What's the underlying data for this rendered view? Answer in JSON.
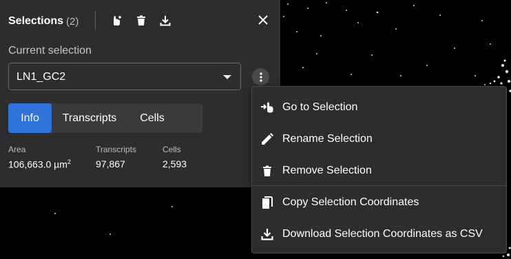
{
  "panel": {
    "title": "Selections",
    "count": "(2)",
    "icons": [
      "pointer-add-icon",
      "trash-icon",
      "download-icon"
    ],
    "close_icon": "close-icon",
    "current_selection_label": "Current selection",
    "select": {
      "value": "LN1_GC2",
      "caret_icon": "caret-down-icon"
    },
    "kebab_icon": "more-vertical-icon",
    "tabs": [
      {
        "label": "Info",
        "active": true
      },
      {
        "label": "Transcripts",
        "active": false
      },
      {
        "label": "Cells",
        "active": false
      }
    ],
    "stats": [
      {
        "label": "Area",
        "value": "106,663.0 µm",
        "sup": "2"
      },
      {
        "label": "Transcripts",
        "value": "97,867"
      },
      {
        "label": "Cells",
        "value": "2,593"
      }
    ]
  },
  "menu": {
    "items": [
      {
        "label": "Go to Selection",
        "icon": "go-to-icon"
      },
      {
        "label": "Rename Selection",
        "icon": "pencil-icon"
      },
      {
        "label": "Remove Selection",
        "icon": "trash-icon"
      },
      {
        "label": "Copy Selection Coordinates",
        "icon": "copy-icon"
      },
      {
        "label": "Download Selection Coordinates as CSV",
        "icon": "download-icon"
      }
    ]
  },
  "colors": {
    "panel_bg": "#2d2d2f",
    "accent": "#2f73d9",
    "background": "#000000"
  }
}
